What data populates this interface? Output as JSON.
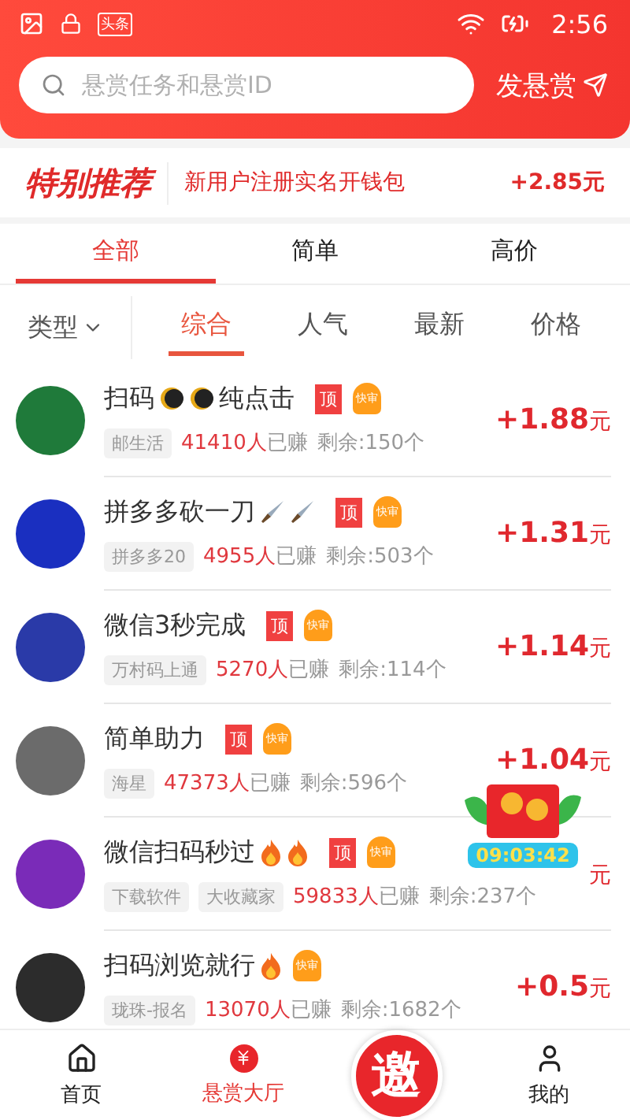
{
  "status_bar": {
    "time": "2:56",
    "badge": "头条"
  },
  "search": {
    "placeholder": "悬赏任务和悬赏ID",
    "post_button": "发悬赏"
  },
  "promo": {
    "title": "特别推荐",
    "text": "新用户注册实名开钱包",
    "reward": "+2.85元"
  },
  "tabs": [
    {
      "label": "全部",
      "selected": true
    },
    {
      "label": "简单",
      "selected": false
    },
    {
      "label": "高价",
      "selected": false
    }
  ],
  "filter": {
    "type_label": "类型",
    "sorts": [
      {
        "label": "综合",
        "selected": true
      },
      {
        "label": "人气",
        "selected": false
      },
      {
        "label": "最新",
        "selected": false
      },
      {
        "label": "价格",
        "selected": false
      }
    ]
  },
  "tasks": [
    {
      "title": "扫码",
      "icons": [
        {
          "kind": "moon"
        },
        {
          "kind": "moon"
        }
      ],
      "title_tail": "纯点击",
      "badges": [
        {
          "kind": "top",
          "text": "顶"
        },
        {
          "kind": "fast",
          "text": "快审"
        }
      ],
      "tags": [
        "邮生活"
      ],
      "earned": "41410人",
      "earned_suffix": "已赚",
      "remaining": "剩余:150个",
      "reward": "+1.88",
      "unit": "元",
      "color": "#1f7a3a"
    },
    {
      "title": "拼多多砍一刀",
      "icons": [
        {
          "kind": "knife"
        },
        {
          "kind": "knife"
        }
      ],
      "badges": [
        {
          "kind": "top",
          "text": "顶"
        },
        {
          "kind": "fast",
          "text": "快审"
        }
      ],
      "tags": [
        "拼多多20"
      ],
      "earned": "4955人",
      "earned_suffix": "已赚",
      "remaining": "剩余:503个",
      "reward": "+1.31",
      "unit": "元",
      "color": "#1a2fc0"
    },
    {
      "title": "微信3秒完成",
      "badges": [
        {
          "kind": "top",
          "text": "顶"
        },
        {
          "kind": "fast",
          "text": "快审"
        }
      ],
      "tags": [
        "万村码上通"
      ],
      "earned": "5270人",
      "earned_suffix": "已赚",
      "remaining": "剩余:114个",
      "reward": "+1.14",
      "unit": "元",
      "color": "#2a3aa8"
    },
    {
      "title": "简单助力",
      "badges": [
        {
          "kind": "top",
          "text": "顶"
        },
        {
          "kind": "fast",
          "text": "快审"
        }
      ],
      "tags": [
        "海星"
      ],
      "earned": "47373人",
      "earned_suffix": "已赚",
      "remaining": "剩余:596个",
      "reward": "+1.04",
      "unit": "元",
      "color": "#6b6b6b"
    },
    {
      "title": "微信扫码秒过",
      "icons": [
        {
          "kind": "fire"
        },
        {
          "kind": "fire"
        }
      ],
      "badges": [
        {
          "kind": "top",
          "text": "顶"
        },
        {
          "kind": "fast",
          "text": "快审"
        }
      ],
      "tags": [
        "下载软件",
        "大收藏家"
      ],
      "earned": "59833人",
      "earned_suffix": "已赚",
      "remaining": "剩余:237个",
      "unit": "元",
      "color": "#7a2bb8"
    },
    {
      "title": "扫码浏览就行",
      "icons": [
        {
          "kind": "fire"
        }
      ],
      "badges": [
        {
          "kind": "fast",
          "text": "快审"
        }
      ],
      "tags": [
        "珑珠-报名"
      ],
      "earned": "13070人",
      "earned_suffix": "已赚",
      "remaining": "剩余:1682个",
      "reward": "+0.5",
      "unit": "元",
      "color": "#2c2c2c"
    }
  ],
  "floating_envelope": {
    "timer": "09:03:42"
  },
  "invite_button": "邀",
  "bottom_nav": [
    {
      "label": "首页",
      "kind": "home",
      "selected": false
    },
    {
      "label": "悬赏大厅",
      "kind": "hall",
      "selected": true
    },
    {
      "label": "我的",
      "kind": "me",
      "selected": false
    }
  ]
}
